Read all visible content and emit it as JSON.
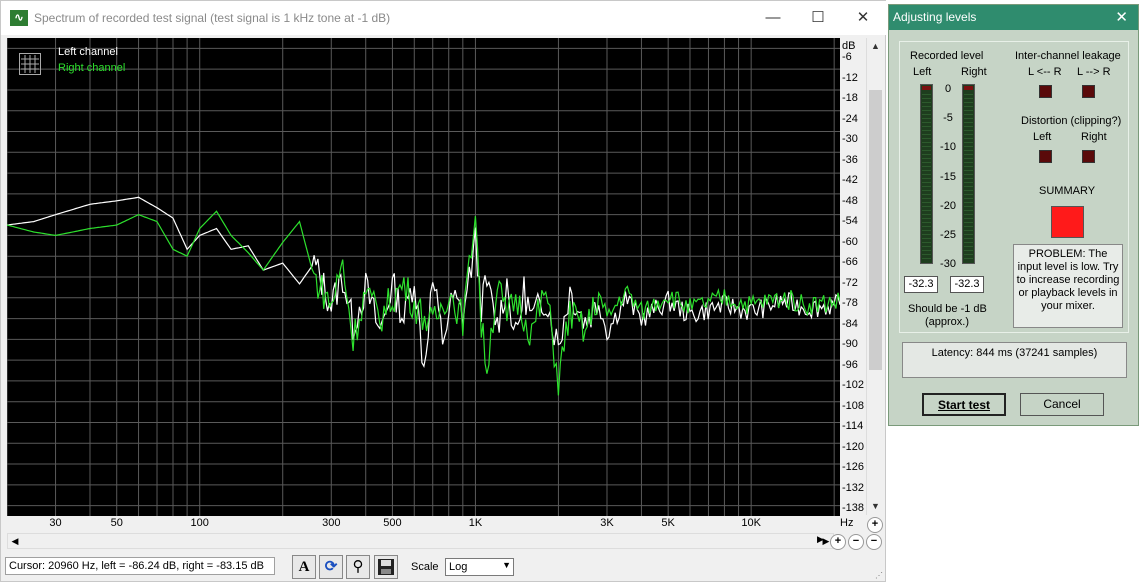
{
  "spectrum_window": {
    "title": "Spectrum of recorded test signal (test signal is 1 kHz tone at -1 dB)",
    "controls": {
      "minimize": "—",
      "maximize": "☐",
      "close": "✕"
    },
    "legend": {
      "left": "Left channel",
      "right": "Right channel"
    },
    "y_unit": "dB",
    "y_ticks": [
      "-6",
      "-12",
      "-18",
      "-24",
      "-30",
      "-36",
      "-42",
      "-48",
      "-54",
      "-60",
      "-66",
      "-72",
      "-78",
      "-84",
      "-90",
      "-96",
      "-102",
      "-108",
      "-114",
      "-120",
      "-126",
      "-132",
      "-138"
    ],
    "x_unit": "Hz",
    "x_ticks": [
      "30",
      "50",
      "100",
      "300",
      "500",
      "1K",
      "3K",
      "5K",
      "10K"
    ],
    "status": "Cursor:  20960 Hz,  left = -86.24 dB,  right = -83.15 dB",
    "scale_label": "Scale",
    "scale_value": "Log",
    "icons": [
      "font-icon",
      "refresh-icon",
      "tools-icon",
      "save-icon",
      "zoom-in-icon",
      "zoom-out-icon"
    ],
    "colors": {
      "left": "#ffffff",
      "right": "#2de02d",
      "background": "#000000",
      "grid": "#5a5a5a"
    }
  },
  "chart_data": {
    "type": "line",
    "xlabel": "Hz",
    "ylabel": "dB",
    "xscale": "log",
    "xlim": [
      20,
      21000
    ],
    "ylim": [
      -141,
      -3
    ],
    "series": [
      {
        "name": "Left channel",
        "color": "#ffffff",
        "points": [
          [
            20,
            -57
          ],
          [
            25,
            -56
          ],
          [
            30,
            -54
          ],
          [
            40,
            -51
          ],
          [
            50,
            -50
          ],
          [
            60,
            -49
          ],
          [
            70,
            -52
          ],
          [
            80,
            -55
          ],
          [
            90,
            -64
          ],
          [
            100,
            -60
          ],
          [
            115,
            -58
          ],
          [
            130,
            -64
          ],
          [
            150,
            -63
          ],
          [
            170,
            -70
          ],
          [
            200,
            -68
          ],
          [
            230,
            -74
          ],
          [
            260,
            -68
          ],
          [
            300,
            -80
          ],
          [
            330,
            -72
          ],
          [
            360,
            -86
          ],
          [
            400,
            -75
          ],
          [
            450,
            -88
          ],
          [
            500,
            -74
          ],
          [
            550,
            -84
          ],
          [
            600,
            -72
          ],
          [
            650,
            -98
          ],
          [
            700,
            -73
          ],
          [
            760,
            -90
          ],
          [
            830,
            -78
          ],
          [
            900,
            -83
          ],
          [
            950,
            -72
          ],
          [
            1000,
            -62
          ],
          [
            1050,
            -80
          ],
          [
            1100,
            -74
          ],
          [
            1200,
            -86
          ],
          [
            1300,
            -74
          ],
          [
            1400,
            -90
          ],
          [
            1500,
            -76
          ],
          [
            1600,
            -84
          ],
          [
            1800,
            -78
          ],
          [
            2000,
            -92
          ],
          [
            2200,
            -76
          ],
          [
            2500,
            -85
          ],
          [
            2800,
            -79
          ],
          [
            3000,
            -88
          ],
          [
            3500,
            -78
          ],
          [
            4000,
            -84
          ],
          [
            5000,
            -79
          ],
          [
            6000,
            -83
          ],
          [
            8000,
            -80
          ],
          [
            10000,
            -82
          ],
          [
            13000,
            -79
          ],
          [
            16000,
            -81
          ],
          [
            21000,
            -80
          ]
        ]
      },
      {
        "name": "Right channel",
        "color": "#2de02d",
        "points": [
          [
            20,
            -57
          ],
          [
            25,
            -59
          ],
          [
            30,
            -60
          ],
          [
            40,
            -58
          ],
          [
            50,
            -57
          ],
          [
            60,
            -54
          ],
          [
            70,
            -56
          ],
          [
            80,
            -64
          ],
          [
            90,
            -66
          ],
          [
            100,
            -58
          ],
          [
            115,
            -53
          ],
          [
            130,
            -60
          ],
          [
            150,
            -65
          ],
          [
            170,
            -70
          ],
          [
            200,
            -62
          ],
          [
            230,
            -56
          ],
          [
            260,
            -72
          ],
          [
            300,
            -80
          ],
          [
            330,
            -68
          ],
          [
            360,
            -90
          ],
          [
            400,
            -76
          ],
          [
            450,
            -84
          ],
          [
            500,
            -78
          ],
          [
            550,
            -74
          ],
          [
            600,
            -80
          ],
          [
            700,
            -86
          ],
          [
            800,
            -76
          ],
          [
            900,
            -84
          ],
          [
            950,
            -70
          ],
          [
            1000,
            -51
          ],
          [
            1050,
            -86
          ],
          [
            1100,
            -98
          ],
          [
            1200,
            -74
          ],
          [
            1300,
            -84
          ],
          [
            1400,
            -78
          ],
          [
            1600,
            -88
          ],
          [
            1800,
            -76
          ],
          [
            2000,
            -102
          ],
          [
            2200,
            -82
          ],
          [
            2500,
            -88
          ],
          [
            2800,
            -77
          ],
          [
            3000,
            -84
          ],
          [
            3500,
            -76
          ],
          [
            4000,
            -82
          ],
          [
            5000,
            -77
          ],
          [
            6000,
            -81
          ],
          [
            8000,
            -78
          ],
          [
            10000,
            -80
          ],
          [
            13000,
            -78
          ],
          [
            16000,
            -80
          ],
          [
            21000,
            -79
          ]
        ]
      }
    ]
  },
  "dialog": {
    "title": "Adjusting levels",
    "close": "✕",
    "recorded_level": "Recorded level",
    "left": "Left",
    "right": "Right",
    "meter_ticks": [
      "0",
      "-5",
      "-10",
      "-15",
      "-20",
      "-25",
      "-30"
    ],
    "left_value": "-32.3",
    "right_value": "-32.3",
    "should_be": "Should be  -1 dB",
    "approx": "(approx.)",
    "leakage": "Inter-channel leakage",
    "leak_lr": "L <-- R",
    "leak_rl": "L --> R",
    "distortion": "Distortion (clipping?)",
    "dist_left": "Left",
    "dist_right": "Right",
    "summary": "SUMMARY",
    "problem": "PROBLEM: The input level is low. Try to increase recording or playback levels in your mixer.",
    "latency": "Latency: 844 ms (37241 samples)",
    "start_test": "Start test",
    "cancel": "Cancel",
    "colors": {
      "summary": "#ff1a1a",
      "led_off": "#5a0a0a",
      "title_bar": "#2f8c6e"
    }
  }
}
